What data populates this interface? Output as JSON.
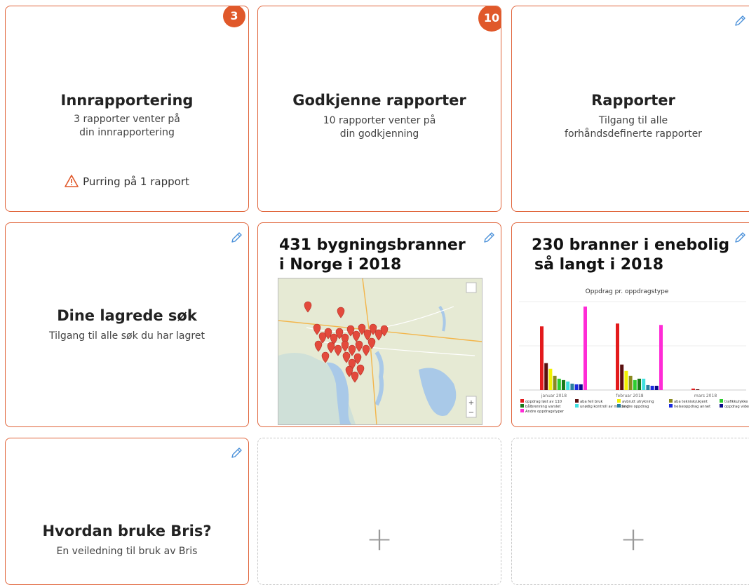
{
  "tiles": {
    "innrapportering": {
      "badge": "3",
      "title": "Innrapportering",
      "subtitle_line1": "3 rapporter venter på",
      "subtitle_line2": "din innrapportering",
      "warning": "Purring på 1 rapport"
    },
    "godkjenne": {
      "badge": "10",
      "title": "Godkjenne rapporter",
      "subtitle_line1": "10 rapporter venter på",
      "subtitle_line2": "din godkjenning"
    },
    "rapporter": {
      "title": "Rapporter",
      "subtitle_line1": "Tilgang til alle",
      "subtitle_line2": "forhåndsdefinerte rapporter"
    },
    "lagrede_sok": {
      "title": "Dine lagrede søk",
      "subtitle_line1": "Tilgang til alle søk du har lagret"
    },
    "bygningsbranner": {
      "title_line1": "431 bygningsbranner",
      "title_line2": "i Norge i 2018"
    },
    "enebolig": {
      "title_line1": "230 branner i enebolig",
      "title_line2": "så langt i 2018"
    },
    "bris": {
      "title": "Hvordan bruke Bris?",
      "subtitle_line1": "En veiledning til bruk av Bris"
    },
    "add_tile_1": {
      "symbol": "+"
    },
    "add_tile_2": {
      "symbol": "+"
    }
  },
  "icons": {
    "edit": "pencil-icon",
    "warning": "warning-triangle-icon",
    "add": "plus-icon",
    "map_marker": "map-marker-icon"
  },
  "colors": {
    "accent": "#e0582a",
    "border": "#e0643a",
    "dashed_border": "#c8c8c8",
    "pencil": "#4a90d9"
  },
  "chart_data": {
    "type": "bar",
    "title": "Oppdrag pr. oppdragstype",
    "categories": [
      "januar 2018",
      "februar 2018",
      "mars 2018"
    ],
    "legend_position": "bottom",
    "series": [
      {
        "name": "oppdrag løst av 110",
        "color": "#e31a1c",
        "values": [
          90,
          94,
          2
        ]
      },
      {
        "name": "aba feil bruk",
        "color": "#5a0f0f",
        "values": [
          38,
          36,
          1
        ]
      },
      {
        "name": "avbrutt utrykning",
        "color": "#f2f200",
        "values": [
          30,
          27,
          0
        ]
      },
      {
        "name": "aba teknisk/ukjent",
        "color": "#8a8a20",
        "values": [
          20,
          20,
          0
        ]
      },
      {
        "name": "trafikkulykke",
        "color": "#2ecc2e",
        "values": [
          16,
          14,
          0
        ]
      },
      {
        "name": "bålbrenning varslet",
        "color": "#1a7a1a",
        "values": [
          14,
          16,
          0
        ]
      },
      {
        "name": "unødig kontroll av melding",
        "color": "#40e0e0",
        "values": [
          12,
          16,
          0
        ]
      },
      {
        "name": "andre oppdrag",
        "color": "#2a7f9e",
        "values": [
          9,
          7,
          0
        ]
      },
      {
        "name": "helseoppdrag annet",
        "color": "#1a2adf",
        "values": [
          8,
          6,
          0
        ]
      },
      {
        "name": "oppdrag viderevarslet andre",
        "color": "#0a0a8a",
        "values": [
          8,
          6,
          0
        ]
      },
      {
        "name": "Andre oppdragstyper",
        "color": "#ff2bd6",
        "values": [
          118,
          92,
          0
        ]
      }
    ],
    "legend_text": [
      "oppdrag løst av 110",
      "aba feil bruk",
      "avbrutt utrykning",
      "aba teknisk/ukjent",
      "trafikkulykke",
      "bålbrenning varslet",
      "unødig kontroll av melding",
      "andre oppdrag",
      "helseoppdrag annet",
      "oppdrag viderevarslet andre",
      "Andre oppdragstyper"
    ]
  }
}
